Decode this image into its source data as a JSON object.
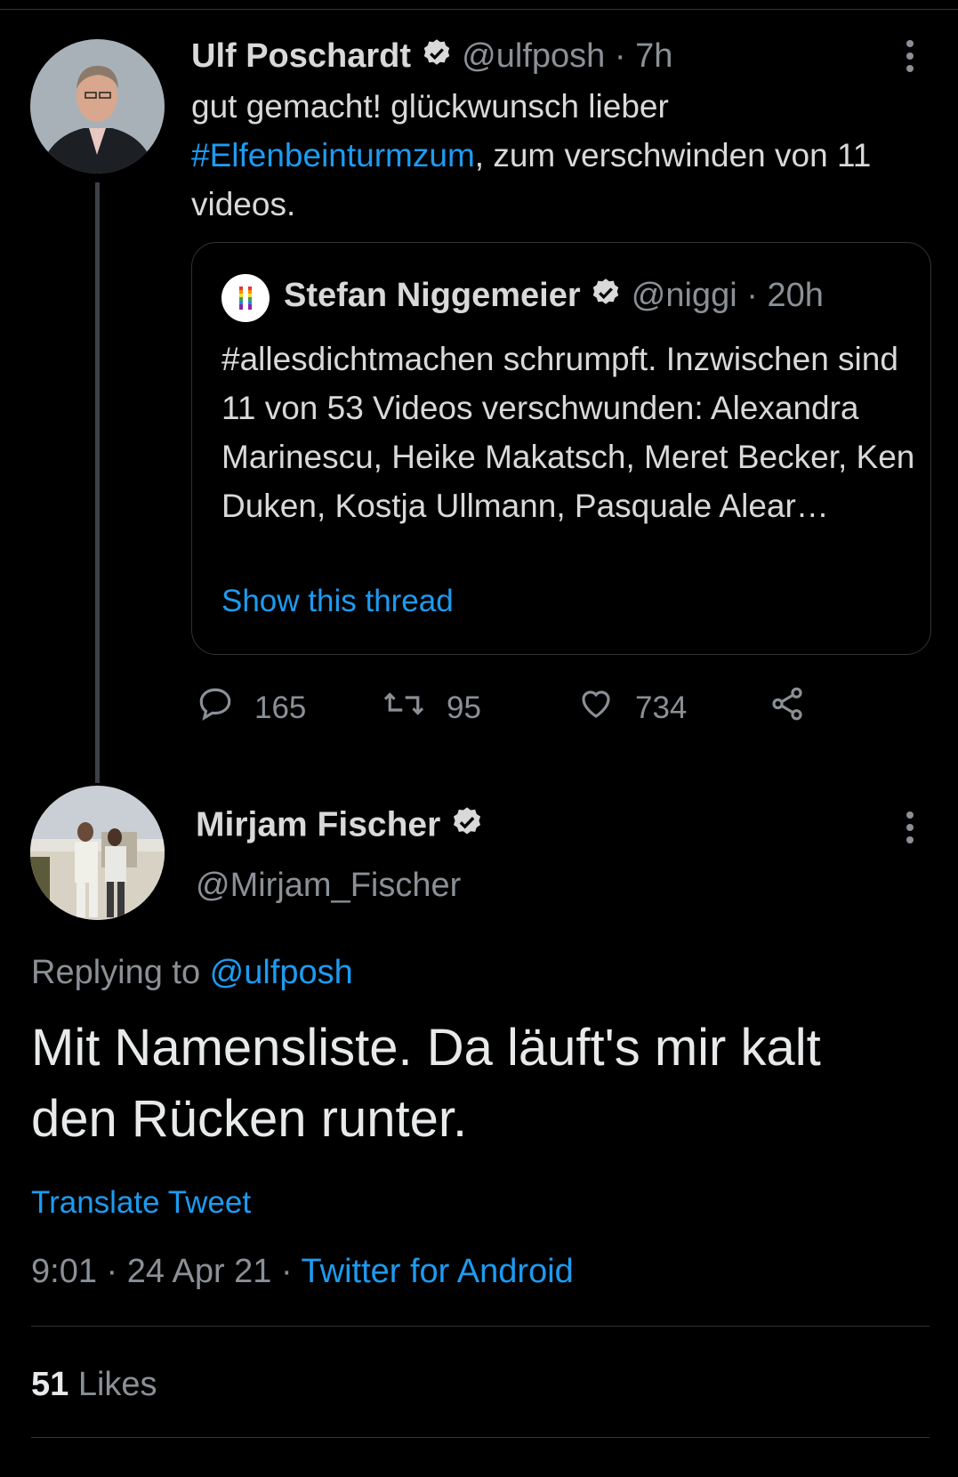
{
  "tweet": {
    "author_name": "Ulf Poschardt",
    "author_handle": "@ulfposh",
    "time_sep": "·",
    "time": "7h",
    "text_before": "gut gemacht! glückwunsch lieber ",
    "hashtag": "#Elfenbeinturmzum",
    "text_after": ", zum verschwinden von 11 videos.",
    "quote": {
      "author_name": "Stefan Niggemeier",
      "author_handle": "@niggi",
      "time_sep": "·",
      "time": "20h",
      "text": "#allesdichtmachen schrumpft. Inzwischen sind 11 von 53 Videos verschwunden: Alexandra Marinescu, Heike Makatsch, Meret Becker, Ken Duken, Kostja Ullmann, Pasquale Alear…",
      "show_thread": "Show this thread"
    },
    "actions": {
      "replies": "165",
      "retweets": "95",
      "likes": "734"
    }
  },
  "reply": {
    "author_name": "Mirjam Fischer",
    "author_handle": "@Mirjam_Fischer",
    "replying_prefix": "Replying to ",
    "replying_to": "@ulfposh",
    "text": "Mit Namensliste. Da läuft's mir kalt den Rücken runter.",
    "translate": "Translate Tweet",
    "time": "9:01",
    "sep1": "·",
    "date": "24 Apr 21",
    "sep2": "·",
    "source": "Twitter for Android",
    "likes_count": "51",
    "likes_label": " Likes"
  },
  "colors": {
    "background": "#000000",
    "link": "#1d9bf0",
    "muted": "#8b9096",
    "text": "#d9d9d9"
  },
  "icons": [
    "verified-icon",
    "more-icon",
    "reply-icon",
    "retweet-icon",
    "like-icon",
    "share-icon",
    "rainbow-flag-icon"
  ]
}
